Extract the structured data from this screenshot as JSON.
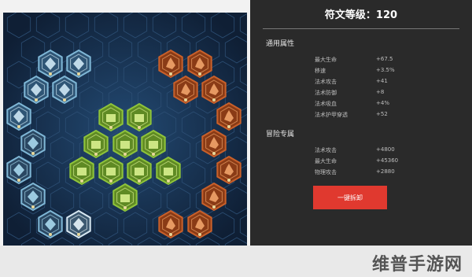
{
  "panel": {
    "title": "符文等级：120",
    "general_title": "通用属性",
    "general_stats": [
      {
        "name": "最大生命",
        "value": "+67.5"
      },
      {
        "name": "移速",
        "value": "+3.5%"
      },
      {
        "name": "法术攻击",
        "value": "+41"
      },
      {
        "name": "法术防御",
        "value": "+8"
      },
      {
        "name": "法术吸血",
        "value": "+4%"
      },
      {
        "name": "法术护甲穿透",
        "value": "+52"
      }
    ],
    "adventure_title": "冒险专属",
    "adventure_stats": [
      {
        "name": "法术攻击",
        "value": "+4800"
      },
      {
        "name": "最大生命",
        "value": "+45360"
      },
      {
        "name": "物理攻击",
        "value": "+2880"
      }
    ],
    "dismantle_label": "一键拆卸"
  },
  "watermark": "维普手游网",
  "colors": {
    "blue_rune": "#7fb7d6",
    "green_rune": "#8fc43a",
    "orange_rune": "#c9602a",
    "button": "#e0392f"
  }
}
